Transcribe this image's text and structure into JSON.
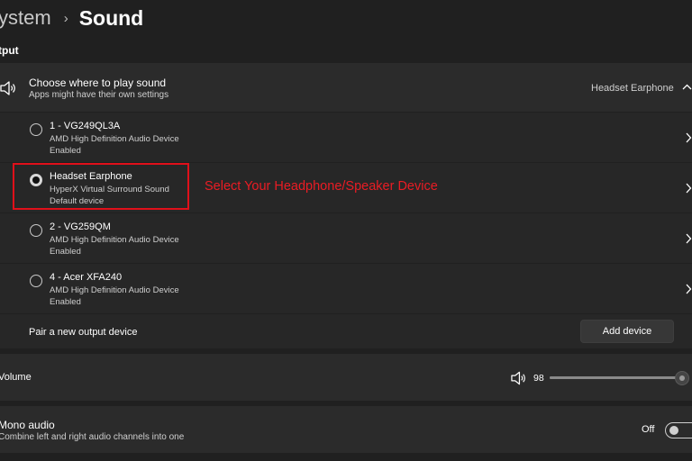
{
  "breadcrumb": {
    "parent": "ystem",
    "current": "Sound"
  },
  "section_label": "tput",
  "choose": {
    "title": "Choose where to play sound",
    "subtitle": "Apps might have their own settings",
    "value": "Headset Earphone"
  },
  "devices": [
    {
      "name": "1 - VG249QL3A",
      "line1": "AMD High Definition Audio Device",
      "line2": "Enabled",
      "selected": false
    },
    {
      "name": "Headset Earphone",
      "line1": "HyperX Virtual Surround Sound",
      "line2": "Default device",
      "selected": true
    },
    {
      "name": "2 - VG259QM",
      "line1": "AMD High Definition Audio Device",
      "line2": "Enabled",
      "selected": false
    },
    {
      "name": "4 - Acer XFA240",
      "line1": "AMD High Definition Audio Device",
      "line2": "Enabled",
      "selected": false
    }
  ],
  "annotation": "Select Your Headphone/Speaker Device",
  "pair": {
    "label": "Pair a new output device",
    "button": "Add device"
  },
  "volume": {
    "label": "Volume",
    "value": "98",
    "level": 98
  },
  "mono": {
    "title": "Mono audio",
    "subtitle": "Combine left and right audio channels into one",
    "state": "Off"
  },
  "colors": {
    "background": "#202020",
    "panel": "#2b2b2b",
    "annotation": "#ea1c24"
  },
  "icons": {
    "speaker": "speaker-icon",
    "chevron_up": "chevron-up-icon",
    "chevron_right": "chevron-right-icon",
    "chevron_breadcrumb": "chevron-right-icon"
  }
}
